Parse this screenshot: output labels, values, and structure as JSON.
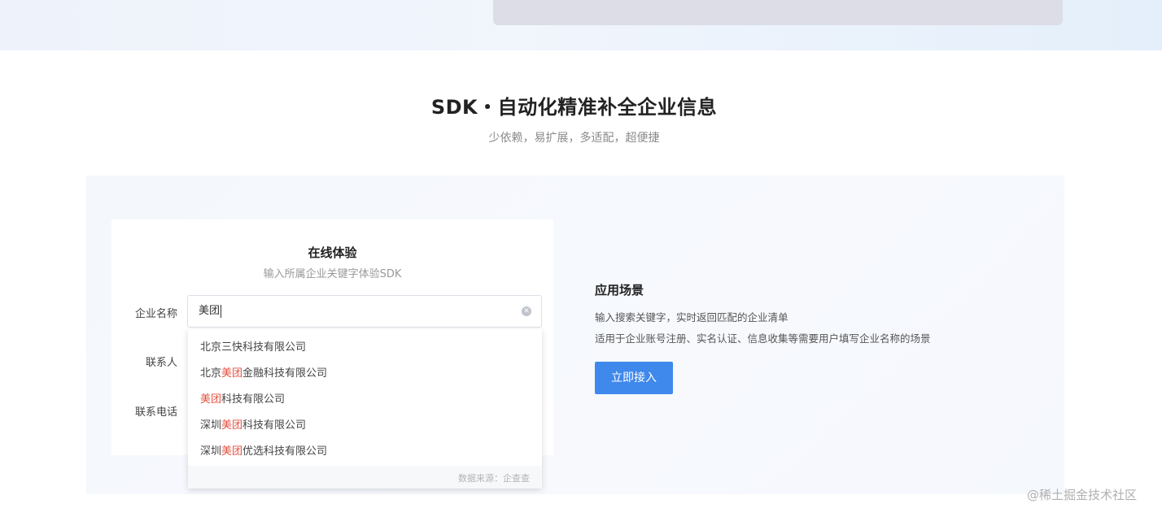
{
  "section": {
    "title": "SDK・自动化精准补全企业信息",
    "subtitle": "少依赖，易扩展，多适配，超便捷"
  },
  "demo": {
    "title": "在线体验",
    "subtitle": "输入所属企业关键字体验SDK",
    "labels": {
      "company": "企业名称",
      "contact": "联系人",
      "phone": "联系电话"
    },
    "company_input_value": "美团",
    "clear_icon": "close-circle-icon",
    "suggestions": [
      {
        "before": "北京三快科技有限公司",
        "match": "",
        "after": ""
      },
      {
        "before": "北京",
        "match": "美团",
        "after": "金融科技有限公司"
      },
      {
        "before": "",
        "match": "美团",
        "after": "科技有限公司"
      },
      {
        "before": "深圳",
        "match": "美团",
        "after": "科技有限公司"
      },
      {
        "before": "深圳",
        "match": "美团",
        "after": "优选科技有限公司"
      }
    ],
    "data_source": "数据来源：企查查"
  },
  "scenario": {
    "title": "应用场景",
    "line1": "输入搜索关键字，实时返回匹配的企业清单",
    "line2": "适用于企业账号注册、实名认证、信息收集等需要用户填写企业名称的场景",
    "button_label": "立即接入"
  },
  "watermark": "@稀土掘金技术社区",
  "colors": {
    "accent": "#3f88ec",
    "highlight": "#e4513f"
  }
}
